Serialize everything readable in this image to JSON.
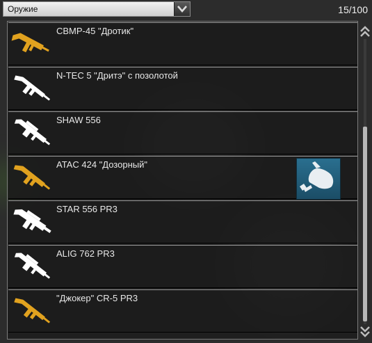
{
  "filter": {
    "selected": "Оружие"
  },
  "counter": "15/100",
  "colors": {
    "gold": "#e1a21f",
    "white": "#ffffff",
    "badge": "#2a6f8f"
  },
  "items": [
    {
      "name": "СВМР-45 \"Дротик\"",
      "icon": "smg-icon",
      "color": "gold"
    },
    {
      "name": "N-TEC 5 \"Дритэ\" с позолотой",
      "icon": "rifle-icon",
      "color": "white"
    },
    {
      "name": "SHAW 556",
      "icon": "lmg-icon",
      "color": "white"
    },
    {
      "name": "ATAC 424 \"Дозорный\"",
      "icon": "rifle-icon",
      "color": "gold",
      "badge": "hand-icon"
    },
    {
      "name": "STAR 556 PR3",
      "icon": "assault-rifle-icon",
      "color": "white"
    },
    {
      "name": "ALIG 762 PR3",
      "icon": "lmg-icon",
      "color": "white"
    },
    {
      "name": "\"Джокер\" CR-5 PR3",
      "icon": "rifle-icon",
      "color": "gold"
    }
  ]
}
